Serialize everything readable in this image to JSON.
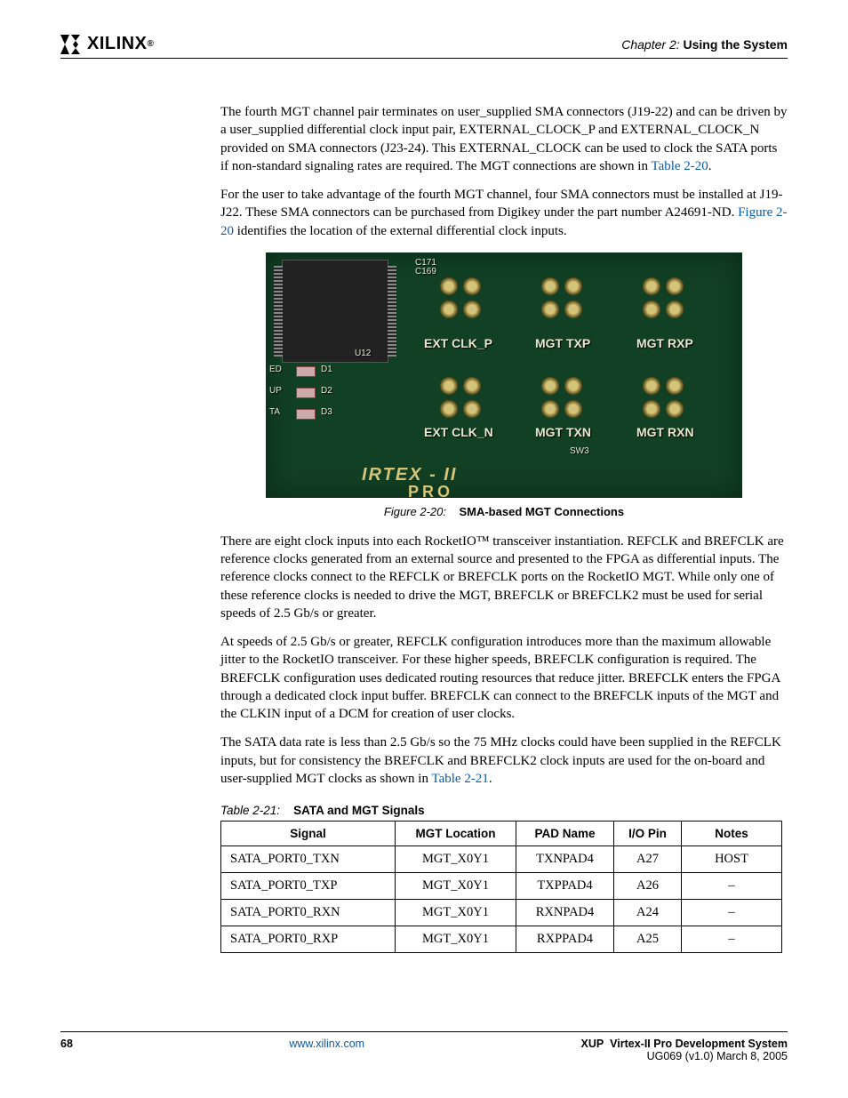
{
  "header": {
    "logo_text": "XILINX",
    "chapter_label": "Chapter 2:",
    "chapter_title": "Using the System"
  },
  "body": {
    "p1_a": "The fourth MGT channel pair terminates on user_supplied SMA connectors (J19-22) and can be driven by a user_supplied differential clock input pair, EXTERNAL_CLOCK_P and EXTERNAL_CLOCK_N provided on SMA connectors (J23-24). This EXTERNAL_CLOCK can be used to clock the SATA ports if non-standard signaling rates are required. The MGT connections are shown in ",
    "p1_link": "Table 2-20",
    "p1_b": ".",
    "p2_a": "For the user to take advantage of the fourth MGT channel, four SMA connectors must be installed at J19-J22. These SMA connectors can be purchased from Digikey under the part number A24691-ND. ",
    "p2_link": "Figure 2-20",
    "p2_b": " identifies the location of the external differential clock inputs.",
    "p3": "There are eight clock inputs into each RocketIO™ transceiver instantiation. REFCLK and BREFCLK are reference clocks generated from an external source and presented to the FPGA as differential inputs. The reference clocks connect to the REFCLK or BREFCLK ports on the RocketIO MGT. While only one of these reference clocks is needed to drive the MGT, BREFCLK or BREFCLK2 must be used for serial speeds of 2.5 Gb/s or greater.",
    "p4": "At speeds of 2.5 Gb/s or greater, REFCLK configuration introduces more than the maximum allowable jitter to the RocketIO transceiver. For these higher speeds, BREFCLK configuration is required. The BREFCLK configuration uses dedicated routing resources that reduce jitter. BREFCLK enters the FPGA through a dedicated clock input buffer. BREFCLK can connect to the BREFCLK inputs of the MGT and the CLKIN input of a DCM for creation of user clocks.",
    "p5_a": "The SATA data rate is less than 2.5 Gb/s so the 75 MHz clocks could have been supplied in the REFCLK inputs, but for consistency the BREFCLK and BREFCLK2 clock inputs are used for the on-board and user-supplied MGT clocks as shown in ",
    "p5_link": "Table 2-21",
    "p5_b": "."
  },
  "figure": {
    "label": "Figure 2-20:",
    "title": "SMA-based MGT Connections",
    "silk": {
      "ext_clk_p": "EXT  CLK_P",
      "ext_clk_n": "EXT  CLK_N",
      "mgt_txp": "MGT  TXP",
      "mgt_txn": "MGT  TXN",
      "mgt_rxp": "MGT  RXP",
      "mgt_rxn": "MGT  RXN",
      "brand1": "IRTEX - II",
      "brand2": "PRO",
      "u12": "U12",
      "sw3": "SW3",
      "c171": "C171",
      "c169": "C169",
      "ed": "ED",
      "up": "UP",
      "ta": "TA",
      "d1": "D1",
      "d2": "D2",
      "d3": "D3"
    }
  },
  "table": {
    "label": "Table 2-21:",
    "title": "SATA and MGT Signals",
    "headers": [
      "Signal",
      "MGT Location",
      "PAD Name",
      "I/O Pin",
      "Notes"
    ],
    "rows": [
      [
        "SATA_PORT0_TXN",
        "MGT_X0Y1",
        "TXNPAD4",
        "A27",
        "HOST"
      ],
      [
        "SATA_PORT0_TXP",
        "MGT_X0Y1",
        "TXPPAD4",
        "A26",
        "–"
      ],
      [
        "SATA_PORT0_RXN",
        "MGT_X0Y1",
        "RXNPAD4",
        "A24",
        "–"
      ],
      [
        "SATA_PORT0_RXP",
        "MGT_X0Y1",
        "RXPPAD4",
        "A25",
        "–"
      ]
    ]
  },
  "footer": {
    "page": "68",
    "url": "www.xilinx.com",
    "doc_title": "XUP  Virtex-II Pro Development System",
    "doc_id": "UG069 (v1.0) March 8, 2005"
  }
}
